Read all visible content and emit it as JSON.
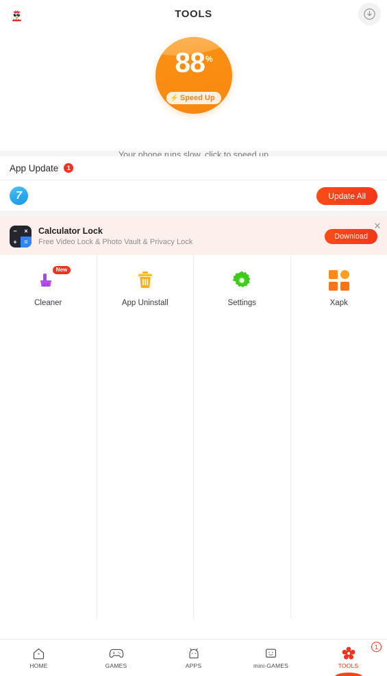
{
  "header": {
    "title": "TOOLS",
    "avatar_icon": "chick-avatar-icon",
    "download_icon": "download-circle-icon"
  },
  "gauge": {
    "value": "88",
    "unit": "%",
    "bolt": "⚡",
    "speed_up_label": "Speed Up",
    "caption": "Your phone runs slow, click to speed up",
    "accent_color": "#fa8d12",
    "dots": [
      {
        "active": true
      },
      {
        "active": false
      }
    ]
  },
  "app_update": {
    "title": "App Update",
    "count": "1",
    "count_color": "#f4321d",
    "row": {
      "app_icon_text": "7",
      "app_icon_color": "#29a8ef",
      "update_all_label": "Update All",
      "update_all_color": "#f4371a"
    }
  },
  "ad": {
    "icon": "calculator-icon",
    "calc_keys": [
      "−",
      "×",
      "+",
      "="
    ],
    "title": "Calculator Lock",
    "subtitle": "Free Video Lock & Photo Vault & Privacy Lock",
    "download_label": "Download",
    "close_icon": "close-icon",
    "background_color": "#fdf0ec"
  },
  "tools": [
    {
      "label": "Cleaner",
      "icon": "broom-icon",
      "badge": "New",
      "color": "#a24de0"
    },
    {
      "label": "App Uninstall",
      "icon": "trash-icon",
      "badge": null,
      "color": "#f9b01e"
    },
    {
      "label": "Settings",
      "icon": "gear-icon",
      "badge": null,
      "color": "#3fc91c"
    },
    {
      "label": "Xapk",
      "icon": "xapk-icon",
      "badge": null,
      "color": "#fb8a1a"
    }
  ],
  "bottom_nav": {
    "items": [
      {
        "label": "HOME",
        "icon": "home-icon",
        "active": false,
        "badge": null
      },
      {
        "label": "GAMES",
        "icon": "gamepad-icon",
        "active": false,
        "badge": null
      },
      {
        "label": "APPS",
        "icon": "android-icon",
        "active": false,
        "badge": null
      },
      {
        "label": "mini-GAMES",
        "icon": "smiley-screen-icon",
        "active": false,
        "badge": null
      },
      {
        "label": "TOOLS",
        "icon": "flower-gear-icon",
        "active": true,
        "badge": "1"
      }
    ],
    "active_color": "#f4321d"
  }
}
